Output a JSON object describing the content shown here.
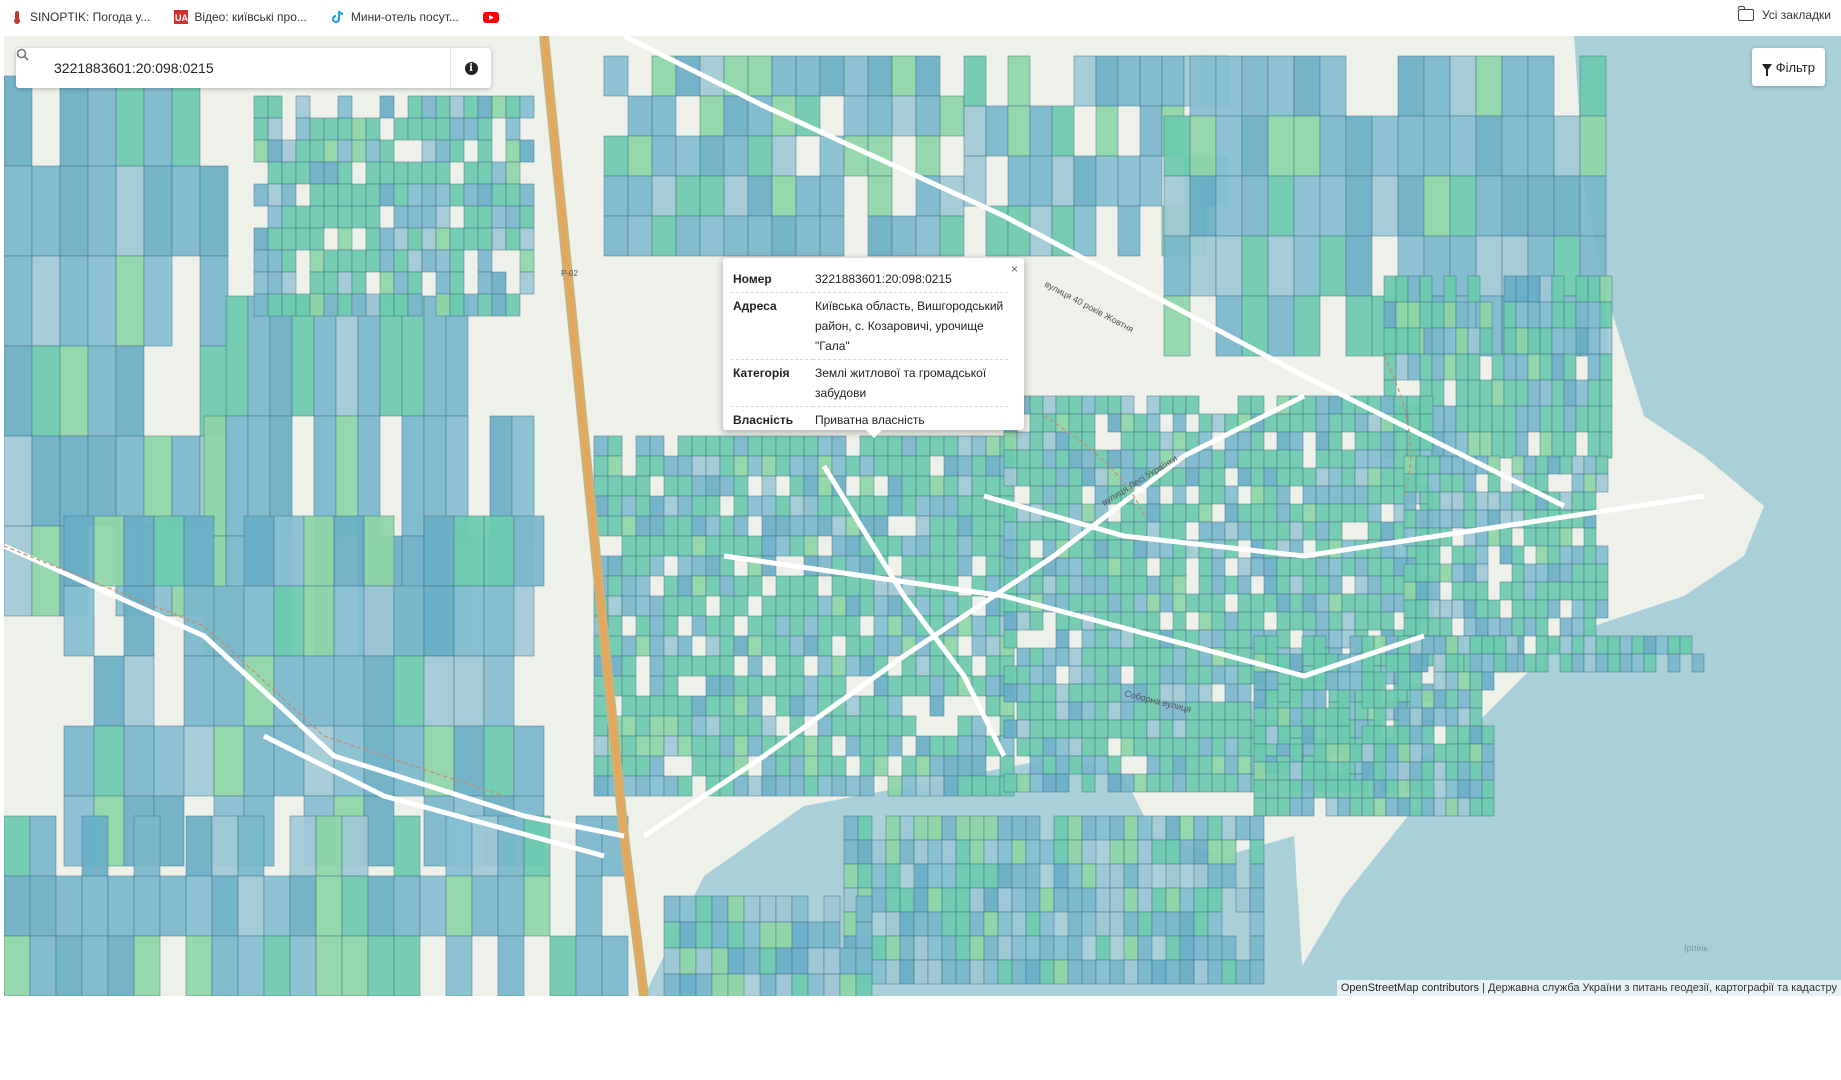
{
  "bookmarks": [
    {
      "label": "SINOPTIK: Погода у...",
      "icon": "thermometer-icon",
      "color": "#c0392b"
    },
    {
      "label": "Відео: київські про...",
      "icon": "ua-logo-icon",
      "color": "#d32f2f"
    },
    {
      "label": "Мини-отель посут...",
      "icon": "tiktok-icon",
      "color": "#1da1f2"
    },
    {
      "label": "",
      "icon": "youtube-icon",
      "color": "#ff0000"
    }
  ],
  "bookmarks_all": "Усі закладки",
  "search": {
    "value": "3221883601:20:098:0215"
  },
  "filter_label": "Фільтр",
  "popup": {
    "close": "×",
    "rows": [
      {
        "key": "Номер",
        "value": "3221883601:20:098:0215"
      },
      {
        "key": "Адреса",
        "value": "Київська область, Вишгородський район, с. Козаровичі, урочище \"Гала\""
      },
      {
        "key": "Категорія",
        "value": "Землі житлової та громадської забудови"
      },
      {
        "key": "Власність",
        "value": "Приватна власність"
      }
    ]
  },
  "attribution": {
    "osm": "OpenStreetMap contributors",
    "separator": " | ",
    "agency": "Державна служба України з питань геодезії, картографії та кадастру"
  },
  "map_labels": {
    "street_40_rokiv": "вулиця 40 років Жовтня",
    "street_lesi": "вулиця Лесі Українки",
    "street_soborna": "Соборна вулиця",
    "road_p02": "Р-02",
    "irpin": "Ірпінь"
  },
  "colors": {
    "water": "#a9cfd8",
    "parcel_blue": "#7ab8cc",
    "parcel_teal": "#6dcbb0",
    "parcel_green": "#8fd6a8",
    "land": "#eef0ea",
    "highway": "#e8a65a"
  }
}
